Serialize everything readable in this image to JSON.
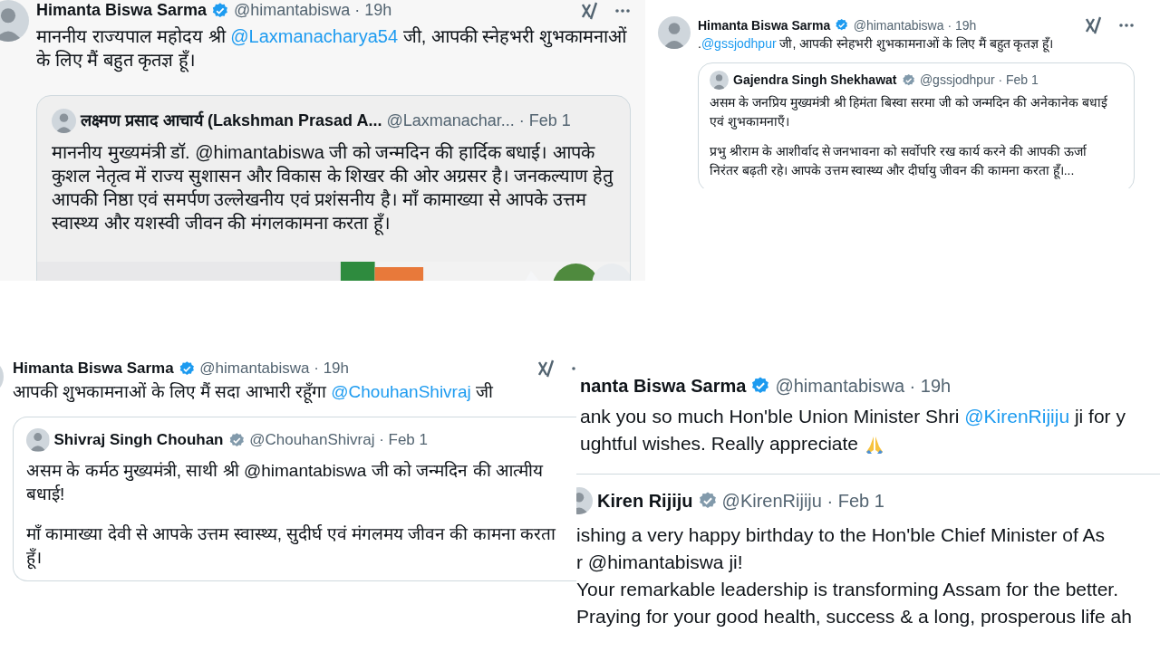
{
  "panels": [
    {
      "tweet": {
        "avatar": true,
        "author": "Himanta Biswa Sarma",
        "verified": true,
        "color": "#1d9bf0",
        "meta": "@himantabiswa · 19h",
        "grok": true,
        "more": true,
        "lines": [
          [
            {
              "kind": "text",
              "text": "माननीय राज्यपाल महोदय श्री "
            },
            {
              "kind": "mention",
              "text": "@Laxmanacharya54"
            },
            {
              "kind": "text",
              "text": " जी, आपकी स्नेहभरी शुभकामनाओं"
            }
          ],
          [
            {
              "kind": "text",
              "text": "के लिए मैं बहुत कृतज्ञ हूँ।"
            }
          ]
        ]
      },
      "quote": {
        "avatar": true,
        "author": "लक्ष्मण प्रसाद आचार्य (Lakshman Prasad A...",
        "meta": "@Laxmanachar... · Feb 1",
        "paragraphs": [
          "माननीय मुख्यमंत्री डॉ. @himantabiswa जी को जन्मदिन की हार्दिक बधाई। आपके कुशल नेतृत्व में राज्य सुशासन और विकास के शिखर की ओर अग्रसर है। जनकल्याण हेतु आपकी निष्ठा एवं समर्पण उल्लेखनीय एवं प्रशंसनीय है। माँ कामाख्या से आपके उत्तम स्वास्थ्य और यशस्वी जीवन की मंगलकामना करता हूँ।"
        ],
        "media": {
          "kind": "picture"
        }
      }
    },
    {
      "tweet": {
        "avatar": true,
        "author": "Himanta Biswa Sarma",
        "verified": true,
        "color": "#1d9bf0",
        "meta": "@himantabiswa · 19h",
        "grok": true,
        "more": true,
        "lines": [
          [
            {
              "kind": "text",
              "text": "."
            },
            {
              "kind": "mention",
              "text": "@gssjodhpur"
            },
            {
              "kind": "text",
              "text": "  जी, आपकी स्नेहभरी शुभकामनाओं के लिए मैं बहुत कृतज्ञ हूँ।"
            }
          ]
        ]
      },
      "quote": {
        "avatar": true,
        "author": "Gajendra Singh Shekhawat",
        "verified": true,
        "color": "#829aab",
        "meta": "@gssjodhpur · Feb 1",
        "paragraphs": [
          "असम के जनप्रिय मुख्यमंत्री श्री हिमंता बिस्वा सरमा जी को जन्मदिन की अनेकानेक बधाई एवं शुभकामनाएँ।",
          "प्रभु श्रीराम के आशीर्वाद से जनभावना को सर्वोपरि रख कार्य करने की आपकी ऊर्जा निरंतर बढ़ती रहे। आपके उत्तम स्वास्थ्य और दीर्घायु जीवन की कामना करता हूँ।..."
        ]
      }
    },
    {
      "tweet": {
        "avatar": true,
        "author": "Himanta Biswa Sarma",
        "verified": true,
        "color": "#1d9bf0",
        "meta": "@himantabiswa · 19h",
        "grok": true,
        "more": true,
        "lines": [
          [
            {
              "kind": "text",
              "text": "आपकी शुभकामनाओं के लिए मैं सदा आभारी रहूँगा "
            },
            {
              "kind": "mention",
              "text": "@ChouhanShivraj"
            },
            {
              "kind": "text",
              "text": "  जी"
            }
          ]
        ]
      },
      "quote": {
        "avatar": true,
        "author": "Shivraj Singh Chouhan",
        "verified": true,
        "color": "#829aab",
        "meta": "@ChouhanShivraj · Feb 1",
        "paragraphs": [
          "असम के कर्मठ मुख्यमंत्री, साथी श्री @himantabiswa जी को जन्मदिन की आत्मीय बधाई!",
          "माँ कामाख्या देवी से आपके उत्तम स्वास्थ्य, सुदीर्घ एवं मंगलमय जीवन की कामना करता हूँ।"
        ]
      }
    },
    {
      "tweet": {
        "author": "nanta Biswa Sarma",
        "verified": true,
        "color": "#1d9bf0",
        "meta": "@himantabiswa · 19h",
        "lines": [
          [
            {
              "kind": "text",
              "text": "ank you so much Hon'ble Union Minister Shri "
            },
            {
              "kind": "mention",
              "text": "@KirenRijiju"
            },
            {
              "kind": "text",
              "text": " ji for y"
            }
          ],
          [
            {
              "kind": "text",
              "text": "ughtful wishes. Really appreciate "
            },
            {
              "kind": "pray"
            }
          ]
        ]
      },
      "quote": {
        "avatar": true,
        "author": "Kiren Rijiju",
        "verified": true,
        "color": "#829aab",
        "meta": "@KirenRijiju · Feb 1",
        "paragraphs": [
          "ishing a very happy birthday to the Hon'ble Chief Minister of As",
          "r @himantabiswa ji!",
          "Your remarkable leadership is transforming Assam for the better.",
          "Praying for your good health, success & a long, prosperous life ah"
        ]
      }
    }
  ]
}
